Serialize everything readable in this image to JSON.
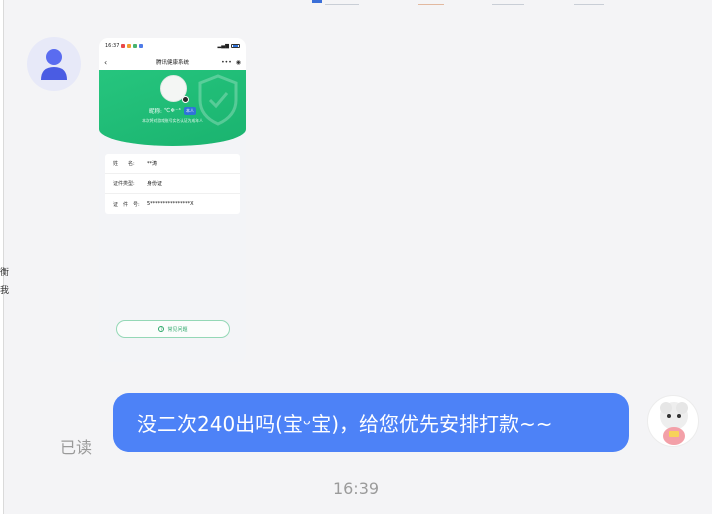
{
  "colors": {
    "page_background": "#f4f4f6",
    "bubble_blue": "#4d82f7",
    "hero_green": "#1ab36f",
    "tag_blue": "#2f73d9",
    "faq_green": "#2ea86b"
  },
  "left_edge_glyphs": [
    "衡",
    "我"
  ],
  "screenshot": {
    "status_time": "16:37",
    "nav_title": "腾讯健康系统",
    "nav_back_icon": "chevron-left-icon",
    "nav_more_icon": "more-dots-icon",
    "nav_target_icon": "target-icon",
    "hero": {
      "nickname_label": "昵称:",
      "nickname_value": "℃❄⁻⁴",
      "tag": "本人",
      "description": "本次将对游戏账号实名认证为成年人"
    },
    "info_rows": [
      {
        "label": "姓　　名:",
        "value": "**涛"
      },
      {
        "label": "证件类型:",
        "value": "身份证"
      },
      {
        "label": "证　件　号:",
        "value": "5****************X"
      }
    ],
    "faq_button": "常见问题"
  },
  "message": {
    "read_status": "已读",
    "text": "没二次240出吗(宝ᵕ宝)，给您优先安排打款~~"
  },
  "timestamp": "16:39"
}
